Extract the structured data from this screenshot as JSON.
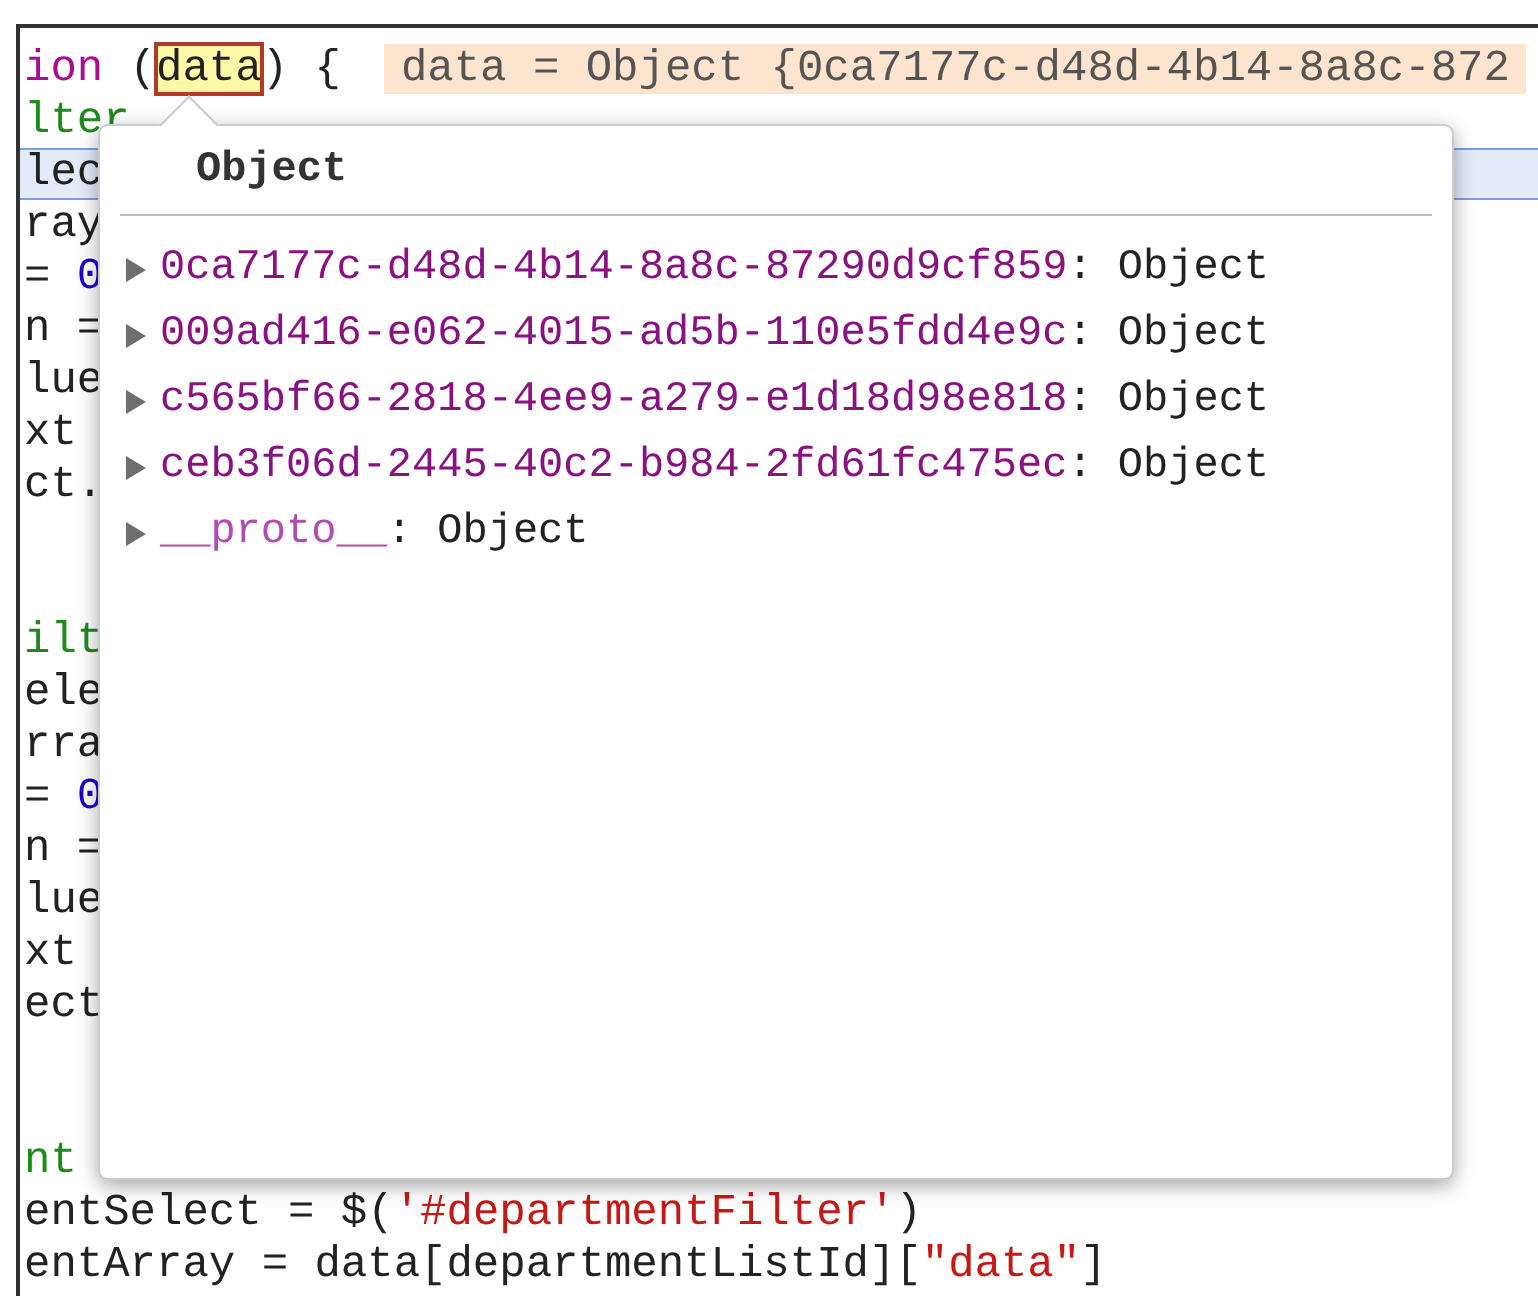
{
  "editor": {
    "lines": [
      {
        "selected": false,
        "tokens": [
          {
            "kind": "keyword",
            "text": "ion"
          },
          {
            "kind": "plain",
            "text": " ("
          },
          {
            "kind": "hovered",
            "text": "data"
          },
          {
            "kind": "plain",
            "text": ") {"
          },
          {
            "kind": "inline_value",
            "text": "data = Object {0ca7177c-d48d-4b14-8a8c-872"
          }
        ]
      },
      {
        "selected": false,
        "tokens": [
          {
            "kind": "green",
            "text": "lter"
          }
        ]
      },
      {
        "selected": true,
        "tokens": [
          {
            "kind": "plain",
            "text": "lec"
          }
        ]
      },
      {
        "selected": false,
        "tokens": [
          {
            "kind": "plain",
            "text": "ray"
          }
        ]
      },
      {
        "selected": false,
        "tokens": [
          {
            "kind": "plain",
            "text": "= "
          },
          {
            "kind": "number",
            "text": "0"
          }
        ]
      },
      {
        "selected": false,
        "tokens": [
          {
            "kind": "plain",
            "text": "n ="
          }
        ]
      },
      {
        "selected": false,
        "tokens": [
          {
            "kind": "plain",
            "text": "lue"
          }
        ]
      },
      {
        "selected": false,
        "tokens": [
          {
            "kind": "plain",
            "text": "xt"
          }
        ]
      },
      {
        "selected": false,
        "tokens": [
          {
            "kind": "plain",
            "text": "ct."
          }
        ]
      },
      {
        "selected": false
      },
      {
        "selected": false
      },
      {
        "selected": false,
        "tokens": [
          {
            "kind": "green",
            "text": "ilt"
          }
        ]
      },
      {
        "selected": false,
        "tokens": [
          {
            "kind": "plain",
            "text": "ele"
          }
        ]
      },
      {
        "selected": false,
        "tokens": [
          {
            "kind": "plain",
            "text": "rra"
          }
        ]
      },
      {
        "selected": false,
        "tokens": [
          {
            "kind": "plain",
            "text": "= "
          },
          {
            "kind": "number",
            "text": "0"
          }
        ]
      },
      {
        "selected": false,
        "tokens": [
          {
            "kind": "plain",
            "text": "n ="
          }
        ]
      },
      {
        "selected": false,
        "tokens": [
          {
            "kind": "plain",
            "text": "lue"
          }
        ]
      },
      {
        "selected": false,
        "tokens": [
          {
            "kind": "plain",
            "text": "xt"
          }
        ]
      },
      {
        "selected": false,
        "tokens": [
          {
            "kind": "plain",
            "text": "ect"
          }
        ]
      },
      {
        "selected": false
      },
      {
        "selected": false
      },
      {
        "selected": false,
        "tokens": [
          {
            "kind": "green",
            "text": "nt"
          }
        ]
      },
      {
        "selected": false,
        "tokens": [
          {
            "kind": "plain",
            "text": "entSelect = $("
          },
          {
            "kind": "string",
            "text": "'#departmentFilter'"
          },
          {
            "kind": "plain",
            "text": ")"
          }
        ]
      },
      {
        "selected": false,
        "tokens": [
          {
            "kind": "plain",
            "text": "entArray = data[departmentListId]["
          },
          {
            "kind": "string",
            "text": "\"data\""
          },
          {
            "kind": "plain",
            "text": "]"
          }
        ]
      }
    ]
  },
  "popover": {
    "title": "Object",
    "properties": [
      {
        "kind": "own",
        "key": "0ca7177c-d48d-4b14-8a8c-87290d9cf859",
        "separator": ":",
        "value": "Object",
        "expanded": false
      },
      {
        "kind": "own",
        "key": "009ad416-e062-4015-ad5b-110e5fdd4e9c",
        "separator": ":",
        "value": "Object",
        "expanded": false
      },
      {
        "kind": "own",
        "key": "c565bf66-2818-4ee9-a279-e1d18d98e818",
        "separator": ":",
        "value": "Object",
        "expanded": false
      },
      {
        "kind": "own",
        "key": "ceb3f06d-2445-40c2-b984-2fd61fc475ec",
        "separator": ":",
        "value": "Object",
        "expanded": false
      },
      {
        "kind": "internal",
        "key": "__proto__",
        "separator": ":",
        "value": "Object",
        "expanded": false
      }
    ]
  }
}
